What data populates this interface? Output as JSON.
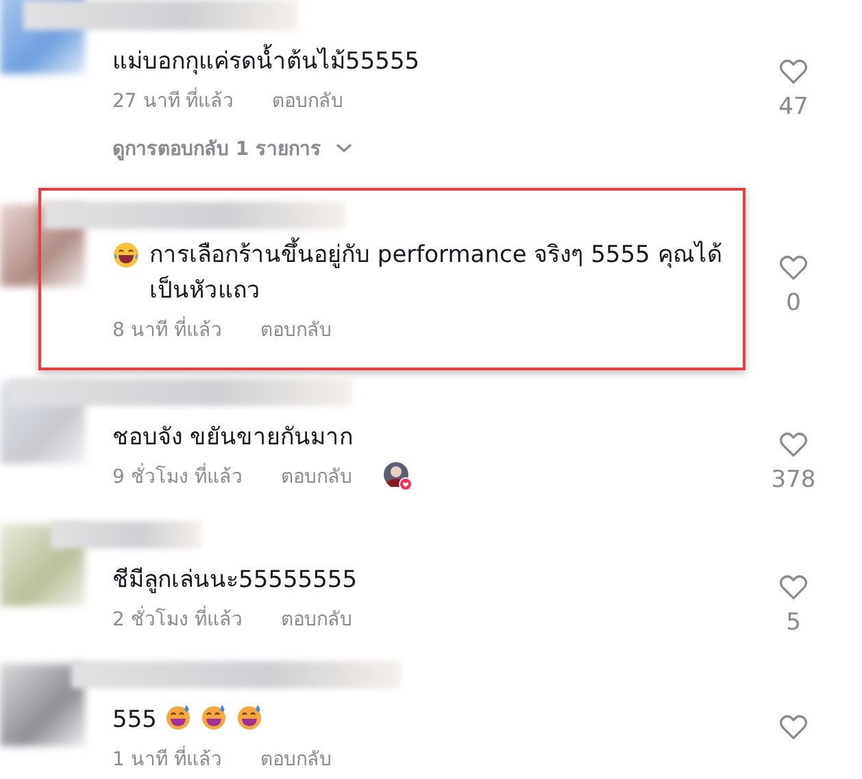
{
  "comments": [
    {
      "text": "แม่บอกกุแค่รดน้ำต้นไม้55555",
      "time": "27 นาที ที่แล้ว",
      "reply": "ตอบกลับ",
      "likes": "47",
      "highlighted": false,
      "liked_by_author": false,
      "replies_label": "ดูการตอบกลับ 1 รายการ"
    },
    {
      "text": "การเลือกร้านขึ้นอยู่กับ performance จริงๆ 5555 คุณได้เป็นหัวแถว",
      "lead_emoji": {
        "kind": "laughing"
      },
      "time": "8 นาที ที่แล้ว",
      "reply": "ตอบกลับ",
      "likes": "0",
      "highlighted": true,
      "liked_by_author": false
    },
    {
      "text": "ชอบจัง ขยันขายกันมาก",
      "time": "9 ชั่วโมง ที่แล้ว",
      "reply": "ตอบกลับ",
      "likes": "378",
      "highlighted": false,
      "liked_by_author": true
    },
    {
      "text": "ชีมีลูกเล่นนะ55555555",
      "time": "2 ชั่วโมง ที่แล้ว",
      "reply": "ตอบกลับ",
      "likes": "5",
      "highlighted": false,
      "liked_by_author": false
    },
    {
      "text": "555",
      "trailing_emojis": [
        {
          "kind": "sweat"
        },
        {
          "kind": "sweat"
        },
        {
          "kind": "sweat"
        }
      ],
      "time": "1 นาที ที่แล้ว",
      "reply": "ตอบกลับ",
      "highlighted": false,
      "liked_by_author": false
    }
  ]
}
